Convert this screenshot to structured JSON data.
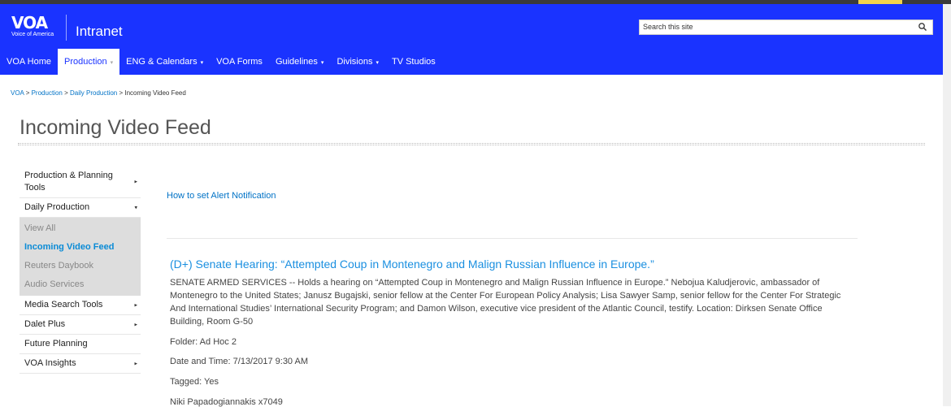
{
  "header": {
    "logo_text": "VOA",
    "logo_subtext": "Voice of America",
    "app_title": "Intranet",
    "search_placeholder": "Search this site"
  },
  "nav": {
    "items": [
      {
        "label": "VOA Home",
        "caret": ""
      },
      {
        "label": "Production",
        "caret": "▾"
      },
      {
        "label": "ENG & Calendars",
        "caret": "▾"
      },
      {
        "label": "VOA Forms",
        "caret": ""
      },
      {
        "label": "Guidelines",
        "caret": "▾"
      },
      {
        "label": "Divisions",
        "caret": "▾"
      },
      {
        "label": "TV Studios",
        "caret": ""
      }
    ]
  },
  "breadcrumb": {
    "items": [
      "VOA",
      "Production",
      "Daily Production"
    ],
    "separator": ">",
    "current": "Incoming Video Feed"
  },
  "page_title": "Incoming Video Feed",
  "sidebar": {
    "items": [
      {
        "label": "Production & Planning Tools",
        "arrow": "▸"
      },
      {
        "label": "Daily Production",
        "arrow": "▾"
      },
      {
        "label": "View All"
      },
      {
        "label": "Incoming Video Feed"
      },
      {
        "label": "Reuters Daybook"
      },
      {
        "label": "Audio Services"
      },
      {
        "label": "Media Search Tools",
        "arrow": "▸"
      },
      {
        "label": "Dalet Plus",
        "arrow": "▸"
      },
      {
        "label": "Future Planning",
        "arrow": ""
      },
      {
        "label": "VOA Insights",
        "arrow": "▸"
      }
    ]
  },
  "main": {
    "alert_link": "How to set Alert Notification",
    "feed": {
      "title": "(D+) Senate Hearing: “Attempted Coup in Montenegro and Malign Russian Influence in Europe.”",
      "description": "SENATE ARMED SERVICES -- Holds a hearing on “Attempted Coup in Montenegro and Malign Russian Influence in Europe.” Nebojua Kaludjerovic, ambassador of Montenegro to the United States; Janusz Bugajski, senior fellow at the Center For European Policy Analysis; Lisa Sawyer Samp, senior fellow for the Center For Strategic And International Studies’ International Security Program; and Damon Wilson, executive vice president of the Atlantic Council, testify. Location: Dirksen Senate Office Building, Room G-50",
      "folder": "Folder: Ad Hoc 2",
      "datetime": "Date and Time: 7/13/2017 9:30 AM",
      "tagged": "Tagged: Yes",
      "contact": "Niki Papadogiannakis x7049"
    }
  },
  "colors": {
    "brand_blue": "#1a33ff",
    "link_blue": "#0072c6",
    "title_blue": "#1a8fe0"
  },
  "icons": [
    "search-icon",
    "chevron-right-icon",
    "chevron-down-icon"
  ]
}
